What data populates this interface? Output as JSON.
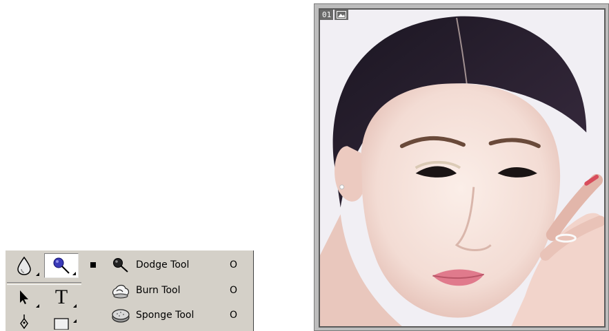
{
  "toolbox": {
    "tools": [
      {
        "name": "blur-icon",
        "flyout": true
      },
      {
        "name": "dodge-icon",
        "flyout": true,
        "active": true
      },
      {
        "name": "path-selection-icon",
        "flyout": true
      },
      {
        "name": "type-icon",
        "label": "T",
        "flyout": true
      },
      {
        "name": "pen-icon",
        "flyout": false
      },
      {
        "name": "rectangle-icon",
        "flyout": true
      }
    ]
  },
  "flyout_menu": {
    "items": [
      {
        "label": "Dodge Tool",
        "shortcut": "O",
        "selected": true,
        "icon": "dodge-icon"
      },
      {
        "label": "Burn Tool",
        "shortcut": "O",
        "selected": false,
        "icon": "burn-icon"
      },
      {
        "label": "Sponge Tool",
        "shortcut": "O",
        "selected": false,
        "icon": "sponge-icon"
      }
    ]
  },
  "document": {
    "badge_number": "01",
    "badge_icon": "image-icon"
  }
}
